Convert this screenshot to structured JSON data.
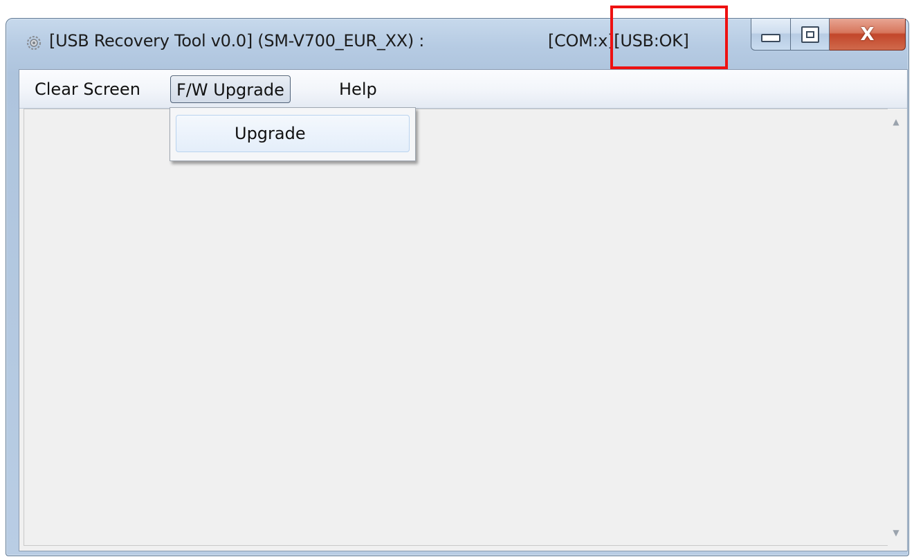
{
  "window": {
    "title": "[USB Recovery Tool v0.0] (SM-V700_EUR_XX) :",
    "status": "[COM:x][USB:OK]",
    "icon": "gear-app-icon",
    "close_glyph": "X"
  },
  "menubar": {
    "items": [
      {
        "label": "Clear Screen"
      },
      {
        "label": "F/W Upgrade"
      },
      {
        "label": "Help"
      }
    ]
  },
  "dropdown": {
    "items": [
      {
        "label": "Upgrade"
      }
    ]
  },
  "colors": {
    "highlight": "#ee1111",
    "close_button": "#c2462a"
  }
}
